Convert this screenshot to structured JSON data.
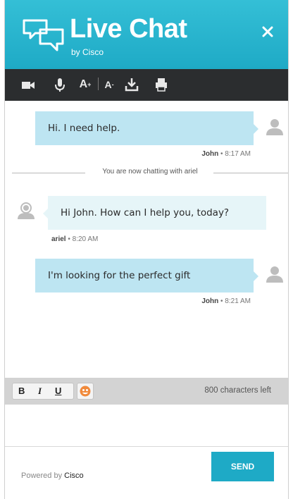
{
  "header": {
    "title": "Live Chat",
    "subtitle": "by Cisco",
    "close_icon": "close-icon",
    "brand_color": "#22adc8"
  },
  "toolbar": {
    "icons": [
      "video-camera-icon",
      "microphone-icon",
      "font-increase-icon",
      "font-decrease-icon",
      "download-icon",
      "print-icon"
    ],
    "font_increase_label": "A",
    "font_decrease_label": "A"
  },
  "chat": {
    "messages": [
      {
        "from": "customer",
        "text": "Hi. I need help.",
        "author": "John",
        "time": "8:17 AM"
      },
      {
        "from": "agent",
        "text": "Hi John. How can I help you, today?",
        "author": "ariel",
        "time": "8:20 AM"
      },
      {
        "from": "customer",
        "text": "I'm looking for the perfect gift",
        "author": "John",
        "time": "8:21 AM"
      }
    ],
    "system_notice": "You are now chatting with ariel",
    "separator": "•"
  },
  "format_bar": {
    "bold": "B",
    "italic": "I",
    "underline": "U",
    "emoji_icon": "emoji-icon",
    "chars_left": "800 characters left"
  },
  "input": {
    "value": "",
    "placeholder": ""
  },
  "footer": {
    "powered_prefix": "Powered by",
    "powered_brand": "Cisco",
    "send_label": "SEND"
  }
}
